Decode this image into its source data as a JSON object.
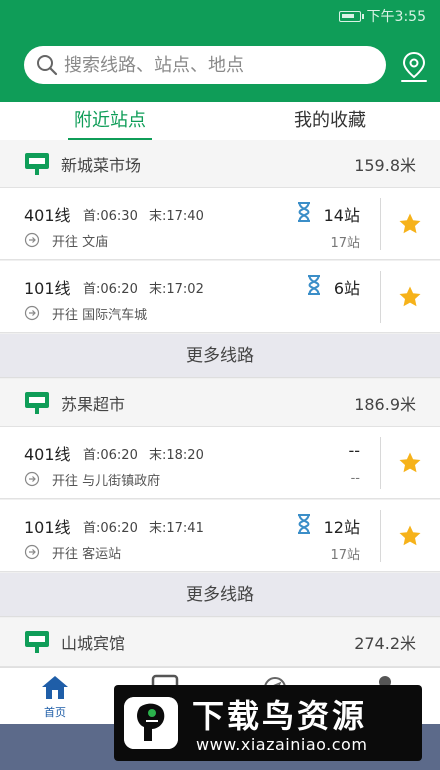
{
  "status": {
    "time": "下午3:55"
  },
  "search": {
    "placeholder": "搜索线路、站点、地点"
  },
  "tabs": [
    {
      "label": "附近站点",
      "active": true
    },
    {
      "label": "我的收藏",
      "active": false
    }
  ],
  "stations": [
    {
      "name": "新城菜市场",
      "distance": "159.8米",
      "routes": [
        {
          "name": "401线",
          "first": "首:06:30",
          "last": "末:17:40",
          "direction": "开往 文庙",
          "stops": "14站",
          "total": "17站",
          "hourglass": true,
          "starred": true
        },
        {
          "name": "101线",
          "first": "首:06:20",
          "last": "末:17:02",
          "direction": "开往 国际汽车城",
          "stops": "6站",
          "total": "",
          "hourglass": true,
          "starred": true
        }
      ]
    },
    {
      "name": "苏果超市",
      "distance": "186.9米",
      "routes": [
        {
          "name": "401线",
          "first": "首:06:20",
          "last": "末:18:20",
          "direction": "开往 与儿街镇政府",
          "stops": "--",
          "total": "--",
          "hourglass": false,
          "starred": true
        },
        {
          "name": "101线",
          "first": "首:06:20",
          "last": "末:17:41",
          "direction": "开往 客运站",
          "stops": "12站",
          "total": "17站",
          "hourglass": true,
          "starred": true
        }
      ]
    },
    {
      "name": "山城宾馆",
      "distance": "274.2米"
    }
  ],
  "more_routes_label": "更多线路",
  "bottom_nav": {
    "home_label": "首页"
  },
  "watermark": {
    "title": "下载鸟资源",
    "url": "www.xiazainiao.com"
  },
  "colors": {
    "brand_green": "#0f9d58",
    "nav_blue": "#1f5ea8",
    "star": "#f6b21a",
    "hourglass": "#3b8ec8"
  }
}
